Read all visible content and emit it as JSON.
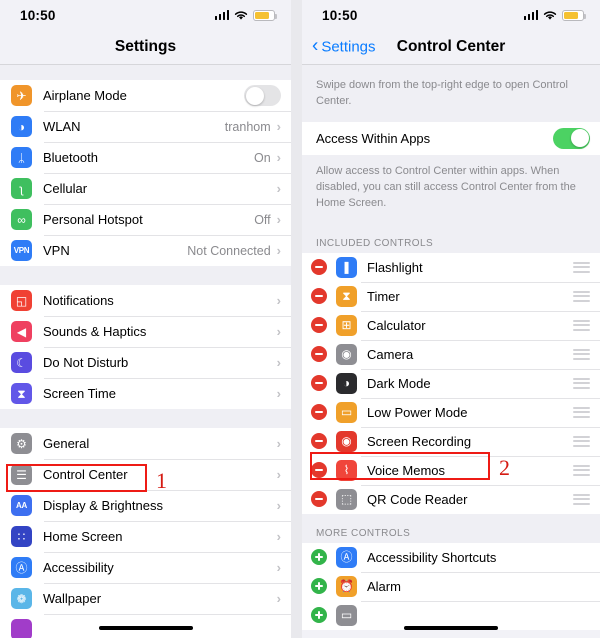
{
  "status": {
    "time": "10:50",
    "signal_icon": "cellular-signal-icon",
    "wifi_icon": "wifi-icon",
    "battery_icon": "battery-icon"
  },
  "left_panel": {
    "nav_title": "Settings",
    "groups": [
      {
        "rows": [
          {
            "label": "Airplane Mode",
            "icon": "airplane-icon",
            "icon_color": "#f0952a",
            "glyph": "✈",
            "control": "toggle",
            "toggle_on": false
          },
          {
            "label": "WLAN",
            "icon": "wifi-icon",
            "icon_color": "#2f7cf6",
            "glyph": "◑",
            "value": "tranhom",
            "control": "chevron"
          },
          {
            "label": "Bluetooth",
            "icon": "bluetooth-icon",
            "icon_color": "#2f7cf6",
            "glyph": "ᛦ",
            "value": "On",
            "control": "chevron"
          },
          {
            "label": "Cellular",
            "icon": "cellular-icon",
            "icon_color": "#3fbf5f",
            "glyph": "ʅ",
            "value": "",
            "control": "chevron"
          },
          {
            "label": "Personal Hotspot",
            "icon": "hotspot-icon",
            "icon_color": "#3fbf5f",
            "glyph": "∞",
            "value": "Off",
            "control": "chevron"
          },
          {
            "label": "VPN",
            "icon": "vpn-icon",
            "icon_color": "#2f7cf6",
            "glyph": "VPN",
            "value": "Not Connected",
            "control": "chevron"
          }
        ]
      },
      {
        "rows": [
          {
            "label": "Notifications",
            "icon": "notifications-icon",
            "icon_color": "#f04134",
            "glyph": "◱",
            "control": "chevron"
          },
          {
            "label": "Sounds & Haptics",
            "icon": "sounds-haptics-icon",
            "icon_color": "#ef4060",
            "glyph": "◀",
            "control": "chevron"
          },
          {
            "label": "Do Not Disturb",
            "icon": "do-not-disturb-icon",
            "icon_color": "#5a4ce0",
            "glyph": "☾",
            "control": "chevron"
          },
          {
            "label": "Screen Time",
            "icon": "screen-time-icon",
            "icon_color": "#6257e8",
            "glyph": "⧗",
            "control": "chevron"
          }
        ]
      },
      {
        "rows": [
          {
            "label": "General",
            "icon": "general-icon",
            "icon_color": "#8e8e93",
            "glyph": "⚙",
            "control": "chevron"
          },
          {
            "label": "Control Center",
            "icon": "control-center-icon",
            "icon_color": "#8e8e93",
            "glyph": "☰",
            "control": "chevron"
          },
          {
            "label": "Display & Brightness",
            "icon": "display-brightness-icon",
            "icon_color": "#3d6ff0",
            "glyph": "AA",
            "control": "chevron"
          },
          {
            "label": "Home Screen",
            "icon": "home-screen-icon",
            "icon_color": "#3344c4",
            "glyph": "∷",
            "control": "chevron"
          },
          {
            "label": "Accessibility",
            "icon": "accessibility-icon",
            "icon_color": "#2f7cf6",
            "glyph": "Ⓐ",
            "control": "chevron"
          },
          {
            "label": "Wallpaper",
            "icon": "wallpaper-icon",
            "icon_color": "#5ab6e8",
            "glyph": "❁",
            "control": "chevron"
          },
          {
            "label": "",
            "icon": "siri-icon",
            "icon_color": "#a13cc9",
            "glyph": "",
            "control": "none"
          }
        ]
      }
    ],
    "annotation": {
      "number": "1",
      "target": "Control Center"
    }
  },
  "right_panel": {
    "back_label": "Settings",
    "nav_title": "Control Center",
    "hint": "Swipe down from the top-right edge to open Control Center.",
    "access_row": {
      "label": "Access Within Apps",
      "toggle_on": true
    },
    "access_footnote": "Allow access to Control Center within apps. When disabled, you can still access Control Center from the Home Screen.",
    "included_header": "INCLUDED CONTROLS",
    "included": [
      {
        "label": "Flashlight",
        "icon": "flashlight-icon",
        "icon_color": "#2f7cf6",
        "glyph": "❚",
        "action": "remove"
      },
      {
        "label": "Timer",
        "icon": "timer-icon",
        "icon_color": "#f0a02a",
        "glyph": "⧗",
        "action": "remove"
      },
      {
        "label": "Calculator",
        "icon": "calculator-icon",
        "icon_color": "#f0a02a",
        "glyph": "⊞",
        "action": "remove"
      },
      {
        "label": "Camera",
        "icon": "camera-icon",
        "icon_color": "#8e8e93",
        "glyph": "◉",
        "action": "remove"
      },
      {
        "label": "Dark Mode",
        "icon": "dark-mode-icon",
        "icon_color": "#2b2b2e",
        "glyph": "◑",
        "action": "remove"
      },
      {
        "label": "Low Power Mode",
        "icon": "low-power-mode-icon",
        "icon_color": "#f0a02a",
        "glyph": "▭",
        "action": "remove"
      },
      {
        "label": "Screen Recording",
        "icon": "screen-recording-icon",
        "icon_color": "#e3382c",
        "glyph": "◉",
        "action": "remove"
      },
      {
        "label": "Voice Memos",
        "icon": "voice-memos-icon",
        "icon_color": "#f0453a",
        "glyph": "⌇",
        "action": "remove"
      },
      {
        "label": "QR Code Reader",
        "icon": "qr-code-reader-icon",
        "icon_color": "#8e8e93",
        "glyph": "⬚",
        "action": "remove"
      }
    ],
    "more_header": "MORE CONTROLS",
    "more": [
      {
        "label": "Accessibility Shortcuts",
        "icon": "accessibility-icon",
        "icon_color": "#2f7cf6",
        "glyph": "Ⓐ",
        "action": "add"
      },
      {
        "label": "Alarm",
        "icon": "alarm-icon",
        "icon_color": "#f0a02a",
        "glyph": "⏰",
        "action": "add"
      },
      {
        "label": "",
        "icon": "apple-tv-remote-icon",
        "icon_color": "#8e8e93",
        "glyph": "▭",
        "action": "add"
      }
    ],
    "annotation": {
      "number": "2",
      "target": "Screen Recording"
    }
  }
}
